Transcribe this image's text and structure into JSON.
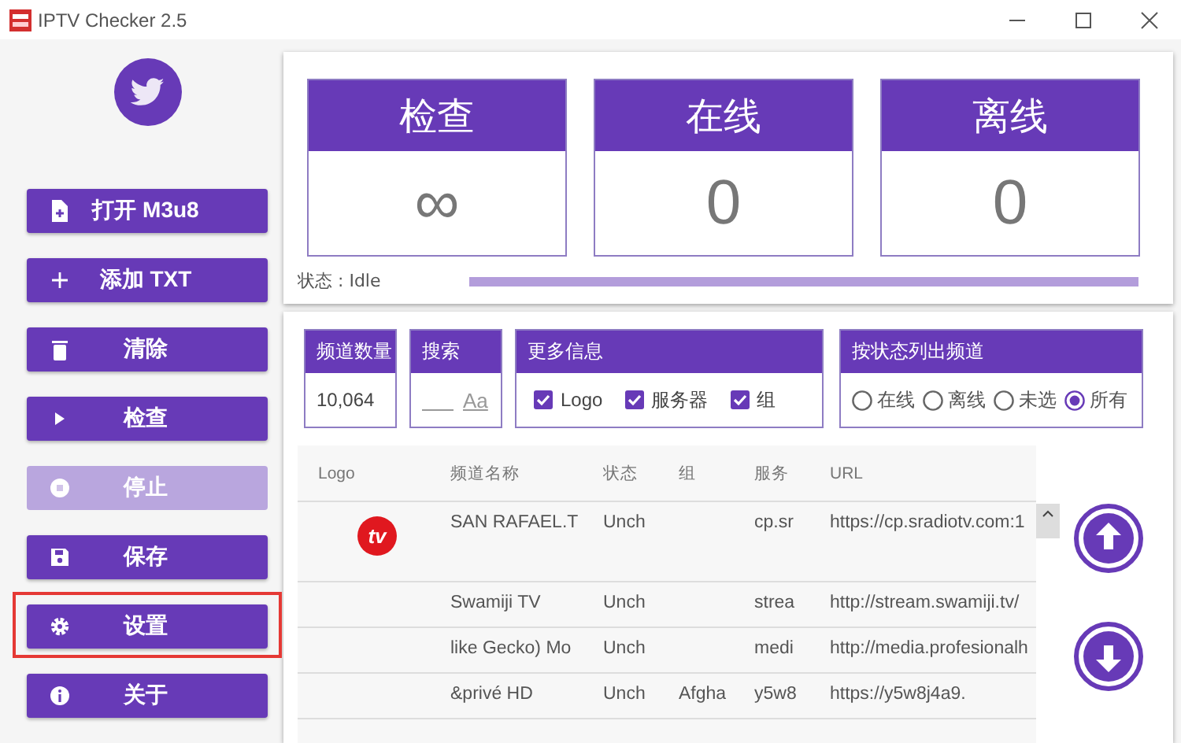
{
  "window": {
    "title": "IPTV Checker 2.5"
  },
  "sidebar": {
    "buttons": [
      {
        "kind": "file",
        "label": "打开 M3u8",
        "disabled": false,
        "highlighted": false
      },
      {
        "kind": "plus",
        "label": "添加 TXT",
        "disabled": false,
        "highlighted": false
      },
      {
        "kind": "trash",
        "label": "清除",
        "disabled": false,
        "highlighted": false
      },
      {
        "kind": "play",
        "label": "检查",
        "disabled": false,
        "highlighted": false
      },
      {
        "kind": "stop",
        "label": "停止",
        "disabled": true,
        "highlighted": false
      },
      {
        "kind": "save",
        "label": "保存",
        "disabled": false,
        "highlighted": false
      },
      {
        "kind": "gear",
        "label": "设置",
        "disabled": false,
        "highlighted": true
      },
      {
        "kind": "info",
        "label": "关于",
        "disabled": false,
        "highlighted": false
      }
    ]
  },
  "stats": [
    {
      "title": "检查",
      "value": "∞"
    },
    {
      "title": "在线",
      "value": "0"
    },
    {
      "title": "离线",
      "value": "0"
    }
  ],
  "status": {
    "label": "状态 : Idle",
    "level": 1
  },
  "filters": {
    "count": {
      "title": "频道数量",
      "value": "10,064"
    },
    "search": {
      "title": "搜索",
      "case_label": "Aa"
    },
    "more_info": {
      "title": "更多信息",
      "options": [
        {
          "label": "Logo",
          "checked": true
        },
        {
          "label": "服务器",
          "checked": true
        },
        {
          "label": "组",
          "checked": true
        }
      ]
    },
    "by_status": {
      "title": "按状态列出频道",
      "options": [
        {
          "label": "在线",
          "selected": false
        },
        {
          "label": "离线",
          "selected": false
        },
        {
          "label": "未选",
          "selected": false
        },
        {
          "label": "所有",
          "selected": true
        }
      ]
    }
  },
  "table": {
    "columns": [
      "Logo",
      "频道名称",
      "状态",
      "组",
      "服务",
      "URL"
    ],
    "rows": [
      {
        "cells": [
          "tv",
          "SAN RAFAEL.T",
          "Unch",
          "",
          "cp.sr",
          "https://cp.sradiotv.com:1"
        ]
      },
      {
        "cells": [
          "",
          "Swamiji TV",
          "Unch",
          "",
          "strea",
          "http://stream.swamiji.tv/"
        ]
      },
      {
        "cells": [
          "",
          "like Gecko) Mo",
          "Unch",
          "",
          "medi",
          "http://media.profesionalh"
        ]
      },
      {
        "cells": [
          "",
          "&privé HD",
          "Unch",
          "Afgha",
          "y5w8",
          "https://y5w8j4a9."
        ]
      }
    ]
  }
}
